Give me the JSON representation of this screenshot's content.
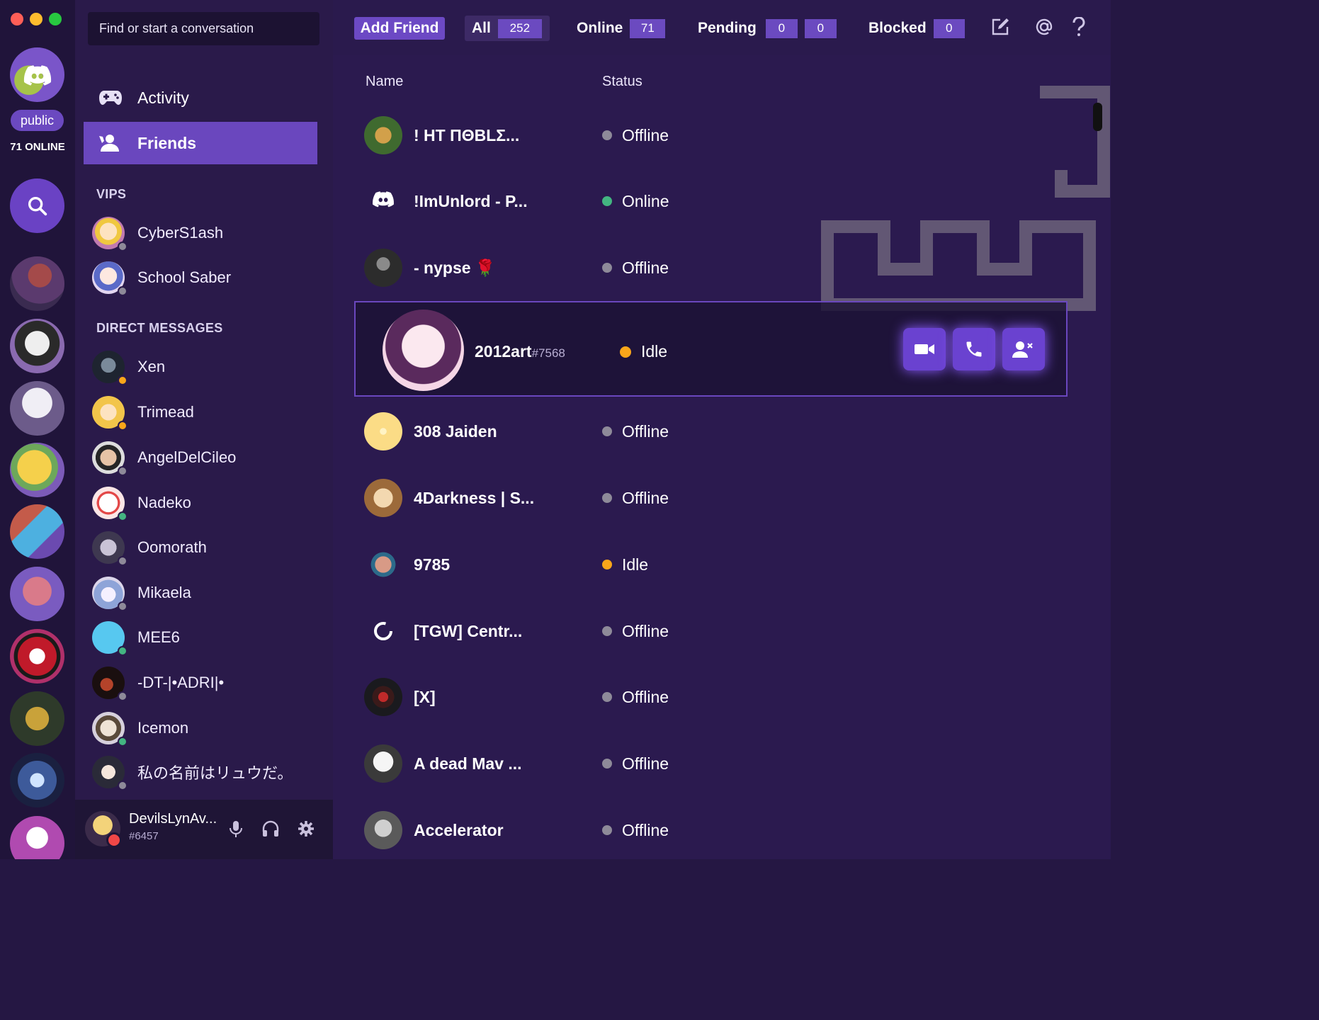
{
  "search": {
    "placeholder": "Find or start a conversation"
  },
  "server_rail": {
    "public_label": "public",
    "online_label": "71 ONLINE"
  },
  "nav": {
    "activity": "Activity",
    "friends": "Friends"
  },
  "vips": {
    "label": "VIPS",
    "items": [
      {
        "name": "CyberS1ash",
        "status": "offline"
      },
      {
        "name": "School Saber",
        "status": "offline"
      }
    ]
  },
  "dms": {
    "label": "DIRECT MESSAGES",
    "items": [
      {
        "name": "Xen",
        "status": "idle"
      },
      {
        "name": "Trimead",
        "status": "idle"
      },
      {
        "name": "AngelDelCileo",
        "status": "offline"
      },
      {
        "name": "Nadeko",
        "status": "online"
      },
      {
        "name": "Oomorath",
        "status": "offline"
      },
      {
        "name": "Mikaela",
        "status": "offline"
      },
      {
        "name": "MEE6",
        "status": "online"
      },
      {
        "name": "-DT-|•ADRI|•",
        "status": "offline"
      },
      {
        "name": "Icemon",
        "status": "online"
      },
      {
        "name": "私の名前はリュウだ。",
        "status": "offline"
      }
    ]
  },
  "user": {
    "name": "DevilsLynAv...",
    "tag": "#6457"
  },
  "topbar": {
    "add_friend": "Add Friend",
    "all_label": "All",
    "all_count": "252",
    "online_label": "Online",
    "online_count": "71",
    "pending_label": "Pending",
    "pending_in": "0",
    "pending_out": "0",
    "blocked_label": "Blocked",
    "blocked_count": "0"
  },
  "columns": {
    "name": "Name",
    "status": "Status"
  },
  "friends": [
    {
      "name": "! ΗΤ ΠΘΒLΣ...",
      "status": "Offline"
    },
    {
      "name": "!ImUnlord - P...",
      "status": "Online"
    },
    {
      "name": "- nypse 🌹",
      "status": "Offline"
    },
    {
      "name": "2012art",
      "tag": "#7568",
      "status": "Idle"
    },
    {
      "name": "308 Jaiden",
      "status": "Offline"
    },
    {
      "name": "4Darkness | S...",
      "status": "Offline"
    },
    {
      "name": "9785",
      "status": "Idle"
    },
    {
      "name": "[TGW] Centr...",
      "status": "Offline"
    },
    {
      "name": "[X]",
      "status": "Offline"
    },
    {
      "name": "A dead Mav ...",
      "status": "Offline"
    },
    {
      "name": "Accelerator",
      "status": "Offline"
    }
  ],
  "colors": {
    "accent": "#6a47be",
    "online": "#43b581",
    "idle": "#faa61a",
    "offline": "#8e8a99",
    "dnd": "#f04747"
  }
}
